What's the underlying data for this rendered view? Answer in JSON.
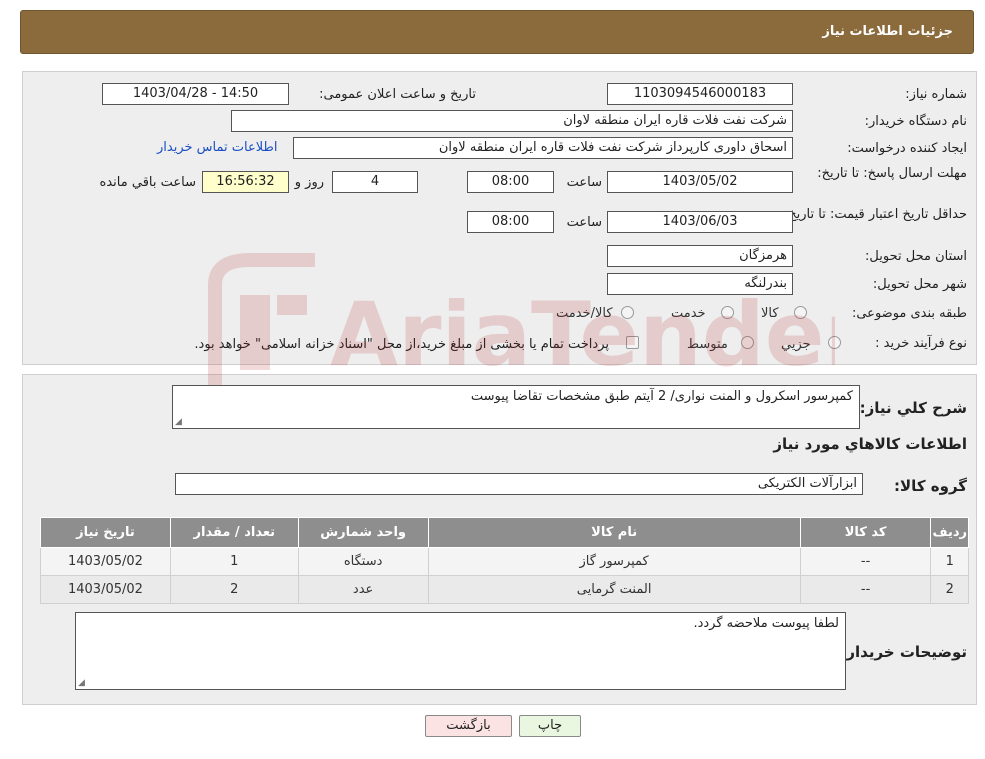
{
  "page": {
    "title": "جزئیات اطلاعات نیاز"
  },
  "form": {
    "need_number_label": "شماره نیاز:",
    "need_number": "1103094546000183",
    "announce_label": "تاریخ و ساعت اعلان عمومی:",
    "announce_value": "1403/04/28 - 14:50",
    "buyer_org_label": "نام دستگاه خریدار:",
    "buyer_org": "شرکت نفت فلات قاره ایران منطقه لاوان",
    "creator_label": "ایجاد کننده درخواست:",
    "creator": "اسحاق داوری کارپرداز شرکت نفت فلات قاره ایران منطقه لاوان",
    "contact_link": "اطلاعات تماس خریدار",
    "reply_deadline_label": "مهلت ارسال پاسخ: تا تاریخ:",
    "reply_date": "1403/05/02",
    "time_label": "ساعت",
    "reply_time": "08:00",
    "days_value": "4",
    "days_label": "روز و",
    "remaining_time": "16:56:32",
    "remaining_label": "ساعت باقي مانده",
    "price_validity_label": "حداقل تاریخ اعتبار قیمت: تا تاریخ:",
    "price_date": "1403/06/03",
    "price_time": "08:00",
    "province_label": "استان محل تحویل:",
    "province": "هرمزگان",
    "city_label": "شهر محل تحویل:",
    "city": "بندرلنگه",
    "category_label": "طبقه بندی موضوعی:",
    "category_options": [
      "کالا",
      "خدمت",
      "کالا/خدمت"
    ],
    "process_label": "نوع فرآیند خرید :",
    "process_options": [
      "جزیي",
      "متوسط"
    ],
    "process_note": "پرداخت تمام یا بخشی از مبلغ خرید،از محل \"اسناد خزانه اسلامی\" خواهد بود."
  },
  "details": {
    "summary_label": "شرح کلي نیاز:",
    "summary": "کمپرسور اسکرول و المنت نواری/ 2 آیتم طبق مشخصات تقاضا پیوست",
    "goods_info_title": "اطلاعات کالاهاي مورد نیاز",
    "goods_group_label": "گروه کالا:",
    "goods_group": "ابزارآلات الکتریکی",
    "table": {
      "headers": [
        "ردیف",
        "کد کالا",
        "نام کالا",
        "واحد شمارش",
        "تعداد / مقدار",
        "تاریخ نیاز"
      ],
      "rows": [
        [
          "1",
          "--",
          "کمپرسور گاز",
          "دستگاه",
          "1",
          "1403/05/02"
        ],
        [
          "2",
          "--",
          "المنت گرمایی",
          "عدد",
          "2",
          "1403/05/02"
        ]
      ]
    },
    "buyer_notes_label": "توضیحات خریدار:",
    "buyer_notes": "لطفا پیوست ملاحضه گردد."
  },
  "buttons": {
    "print": "چاپ",
    "back": "بازگشت"
  },
  "watermark": {
    "text": "AriaTender.neT"
  },
  "colors": {
    "header": "#8b6a3c",
    "link": "#1a4fc4",
    "table_header": "#8e8e8e",
    "print_btn": "#eaf7e0",
    "back_btn": "#fbe3e3"
  }
}
